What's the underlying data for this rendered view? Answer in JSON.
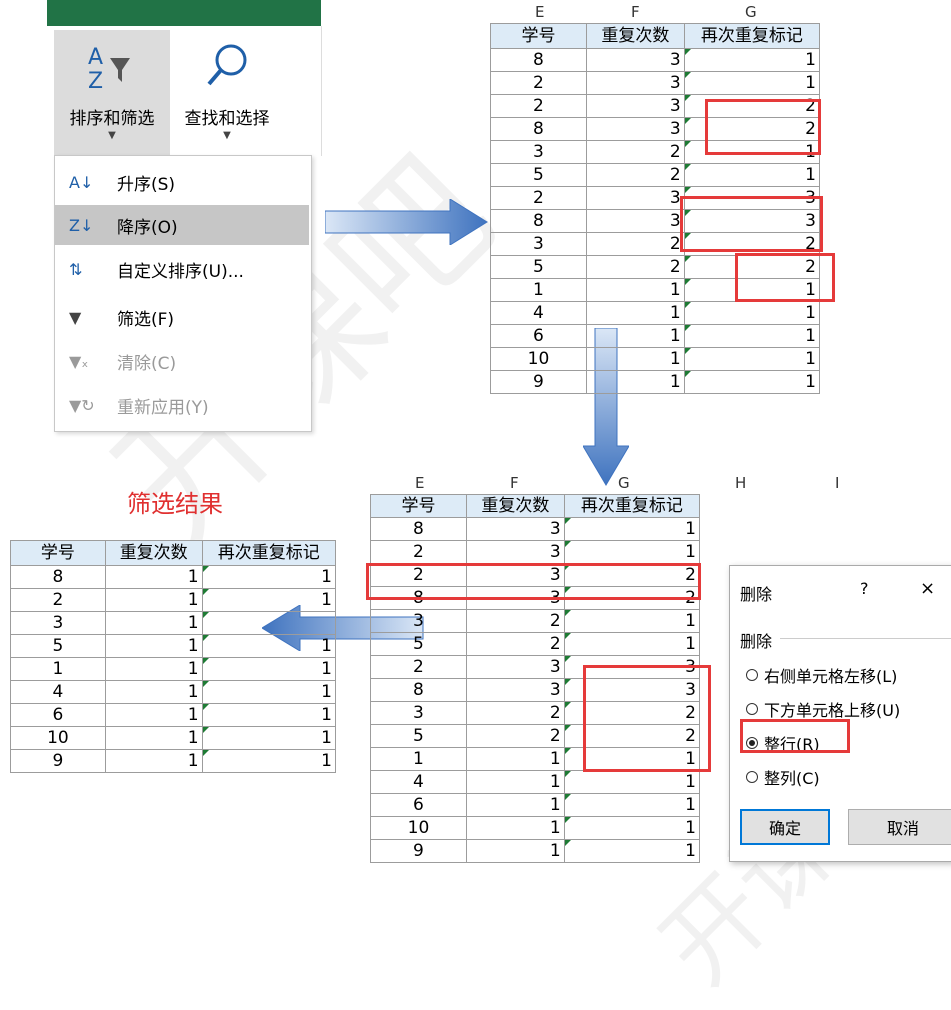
{
  "ribbon": {
    "sort_filter_label": "排序和筛选",
    "find_select_label": "查找和选择"
  },
  "menu": {
    "items": [
      {
        "label": "升序(S)",
        "icon": "sort-asc-icon",
        "state": "normal"
      },
      {
        "label": "降序(O)",
        "icon": "sort-desc-icon",
        "state": "active"
      },
      {
        "label": "自定义排序(U)...",
        "icon": "custom-sort-icon",
        "state": "normal"
      },
      {
        "label": "筛选(F)",
        "icon": "filter-icon",
        "state": "normal"
      },
      {
        "label": "清除(C)",
        "icon": "clear-filter-icon",
        "state": "disabled"
      },
      {
        "label": "重新应用(Y)",
        "icon": "reapply-icon",
        "state": "disabled"
      }
    ]
  },
  "columns": {
    "top_letters": [
      "E",
      "F",
      "G"
    ],
    "mid_letters": [
      "E",
      "F",
      "G",
      "H",
      "I"
    ]
  },
  "headers": [
    "学号",
    "重复次数",
    "再次重复标记"
  ],
  "table_top": {
    "rows": [
      [
        "8",
        "3",
        "1"
      ],
      [
        "2",
        "3",
        "1"
      ],
      [
        "2",
        "3",
        "2"
      ],
      [
        "8",
        "3",
        "2"
      ],
      [
        "3",
        "2",
        "1"
      ],
      [
        "5",
        "2",
        "1"
      ],
      [
        "2",
        "3",
        "3"
      ],
      [
        "8",
        "3",
        "3"
      ],
      [
        "3",
        "2",
        "2"
      ],
      [
        "5",
        "2",
        "2"
      ],
      [
        "1",
        "1",
        "1"
      ],
      [
        "4",
        "1",
        "1"
      ],
      [
        "6",
        "1",
        "1"
      ],
      [
        "10",
        "1",
        "1"
      ],
      [
        "9",
        "1",
        "1"
      ]
    ]
  },
  "table_mid": {
    "rows": [
      [
        "8",
        "3",
        "1"
      ],
      [
        "2",
        "3",
        "1"
      ],
      [
        "2",
        "3",
        "2"
      ],
      [
        "8",
        "3",
        "2"
      ],
      [
        "3",
        "2",
        "1"
      ],
      [
        "5",
        "2",
        "1"
      ],
      [
        "2",
        "3",
        "3"
      ],
      [
        "8",
        "3",
        "3"
      ],
      [
        "3",
        "2",
        "2"
      ],
      [
        "5",
        "2",
        "2"
      ],
      [
        "1",
        "1",
        "1"
      ],
      [
        "4",
        "1",
        "1"
      ],
      [
        "6",
        "1",
        "1"
      ],
      [
        "10",
        "1",
        "1"
      ],
      [
        "9",
        "1",
        "1"
      ]
    ]
  },
  "result": {
    "title": "筛选结果",
    "rows": [
      [
        "8",
        "1",
        "1"
      ],
      [
        "2",
        "1",
        "1"
      ],
      [
        "3",
        "1",
        ""
      ],
      [
        "5",
        "1",
        "1"
      ],
      [
        "1",
        "1",
        "1"
      ],
      [
        "4",
        "1",
        "1"
      ],
      [
        "6",
        "1",
        "1"
      ],
      [
        "10",
        "1",
        "1"
      ],
      [
        "9",
        "1",
        "1"
      ]
    ]
  },
  "dialog": {
    "title": "删除",
    "help": "?",
    "close": "×",
    "group_label": "删除",
    "options": [
      {
        "label": "右侧单元格左移(L)",
        "selected": false
      },
      {
        "label": "下方单元格上移(U)",
        "selected": false
      },
      {
        "label": "整行(R)",
        "selected": true
      },
      {
        "label": "整列(C)",
        "selected": false
      }
    ],
    "ok": "确定",
    "cancel": "取消"
  },
  "watermark": "开课吧",
  "colors": {
    "accent_red": "#e53a3a",
    "header_blue": "#ddebf7",
    "excel_green": "#217346"
  }
}
